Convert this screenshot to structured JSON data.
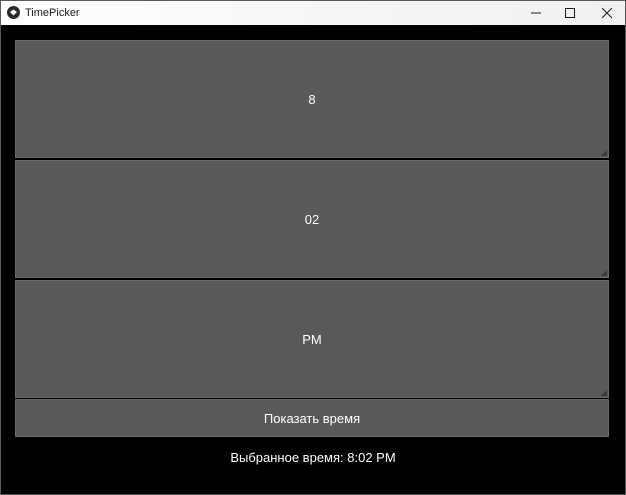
{
  "window": {
    "title": "TimePicker"
  },
  "time_picker": {
    "hours_value": "8",
    "minutes_value": "02",
    "ampm_value": "PM"
  },
  "actions": {
    "show_time_label": "Показать время"
  },
  "result": {
    "text": "Выбранное время: 8:02 PM"
  },
  "icons": {
    "app": "app-logo-icon",
    "minimize": "minimize-icon",
    "maximize": "maximize-icon",
    "close": "close-icon"
  },
  "colors": {
    "background": "#000000",
    "panel": "#595959",
    "text": "#ffffff"
  }
}
